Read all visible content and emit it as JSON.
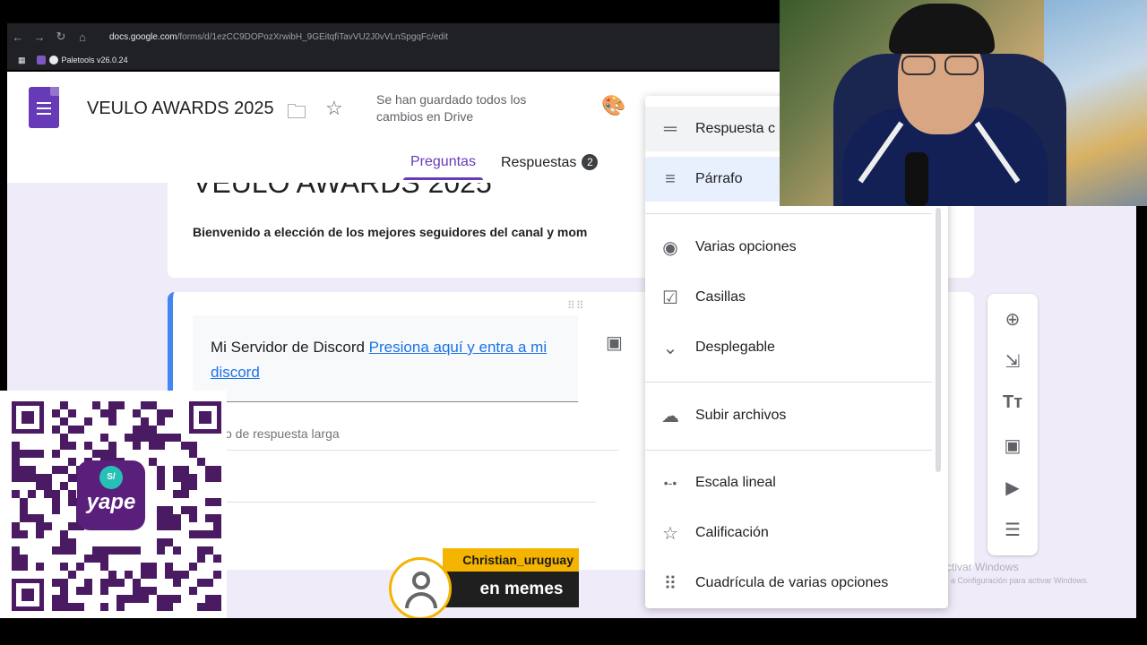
{
  "browser": {
    "nav_icons": [
      "←",
      "→",
      "↻",
      "⌂"
    ],
    "url_domain": "docs.google.com",
    "url_path": "/forms/d/1ezCC9DOPozXrwibH_9GEitqfiTavVU2J0vVLnSpgqFc/edit",
    "bookmark_label": "Paletools v26.0.24"
  },
  "header": {
    "doc_title": "VEULO AWARDS 2025",
    "save_status": "Se han guardado todos los cambios en Drive",
    "tabs": [
      {
        "label": "Preguntas"
      },
      {
        "label": "Respuestas",
        "badge": "2"
      }
    ]
  },
  "form": {
    "title_card": {
      "title": "VEULO AWARDS 2025",
      "description": "Bienvenido a elección de los mejores seguidores del canal y mom"
    },
    "question": {
      "text_prefix": "Mi Servidor de Discord ",
      "link_text": "Presiona aquí y entra a mi discord",
      "answer_hint": "o de respuesta larga"
    }
  },
  "type_menu": {
    "items": [
      {
        "label": "Respuesta c",
        "icon": "short-text-icon",
        "glyph": "═"
      },
      {
        "label": "Párrafo",
        "icon": "paragraph-icon",
        "glyph": "≡"
      },
      {
        "label": "Varias opciones",
        "icon": "radio-icon",
        "glyph": "◉"
      },
      {
        "label": "Casillas",
        "icon": "checkbox-icon",
        "glyph": "☑"
      },
      {
        "label": "Desplegable",
        "icon": "dropdown-icon",
        "glyph": "⌄"
      },
      {
        "label": "Subir archivos",
        "icon": "cloud-upload-icon",
        "glyph": "☁"
      },
      {
        "label": "Escala lineal",
        "icon": "linear-scale-icon",
        "glyph": "•-•"
      },
      {
        "label": "Calificación",
        "icon": "star-icon",
        "glyph": "☆"
      },
      {
        "label": "Cuadrícula de varias opciones",
        "icon": "grid-icon",
        "glyph": "⠿"
      }
    ]
  },
  "side_toolbar": {
    "tools": [
      {
        "icon": "add-question-icon",
        "glyph": "⊕"
      },
      {
        "icon": "import-questions-icon",
        "glyph": "⇲"
      },
      {
        "icon": "title-text-icon",
        "glyph": "Tт"
      },
      {
        "icon": "image-icon",
        "glyph": "▣"
      },
      {
        "icon": "video-icon",
        "glyph": "▶"
      },
      {
        "icon": "section-icon",
        "glyph": "☰"
      }
    ]
  },
  "watermark": {
    "title": "Activar Windows",
    "subtitle": "Ve a Configuración para activar Windows."
  },
  "overlay": {
    "qr_brand": "yape",
    "qr_currency": "S/",
    "alert_name": "Christian_uruguay",
    "alert_text": "en memes"
  },
  "colors": {
    "forms_purple": "#673ab7",
    "canvas_bg": "#f0ebf8",
    "accent_blue": "#4285f4",
    "yape_purple": "#5a1f7a",
    "alert_yellow": "#f4b400"
  }
}
